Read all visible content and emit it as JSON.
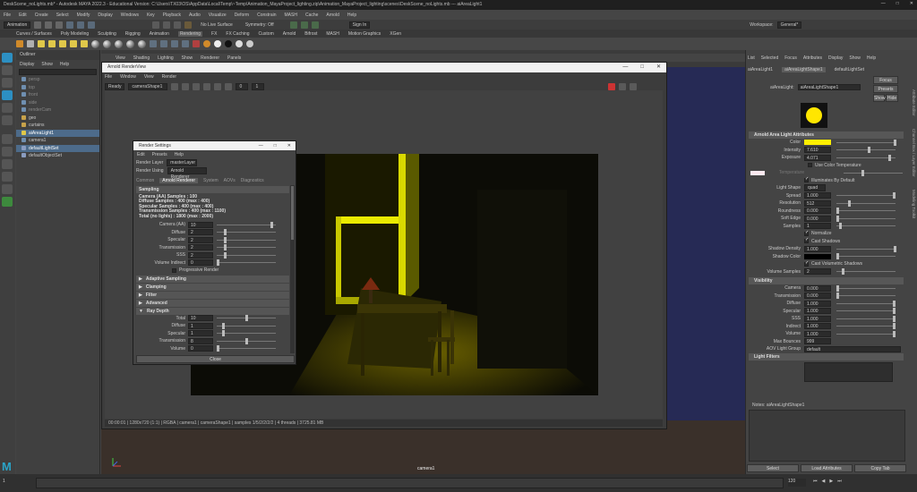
{
  "window": {
    "title": "DeskScene_noLights.mb* - Autodesk MAYA 2022.3 - Educational Version: C:\\Users\\TX03\\OS\\AppData\\Local\\Temp\\~Temp\\Animation_MayaProject_lighting.zip\\Animation_MayaProject_lighting\\scenes\\DeskScene_noLights.mb --- aiAreaLight1"
  },
  "menubar": [
    "File",
    "Edit",
    "Create",
    "Select",
    "Modify",
    "Display",
    "Windows",
    "Key",
    "Playback",
    "Audio",
    "Visualize",
    "Deform",
    "Constrain",
    "MASH",
    "Cache",
    "Arnold",
    "Help"
  ],
  "statusline": {
    "mode": "Animation",
    "no_live_surface": "No Live Surface",
    "symmetry": "Symmetry: Off",
    "sign_in": "Sign In",
    "workspace_label": "Workspace:",
    "workspace": "General*"
  },
  "shelf_tabs": [
    "Curves / Surfaces",
    "Poly Modeling",
    "Sculpting",
    "Rigging",
    "Animation",
    "Rendering",
    "FX",
    "FX Caching",
    "Custom",
    "Arnold",
    "Bifrost",
    "MASH",
    "Motion Graphics",
    "XGen"
  ],
  "shelf_active": "Rendering",
  "outliner": {
    "title": "Outliner",
    "menu": [
      "Display",
      "Show",
      "Help"
    ],
    "items": [
      {
        "label": "persp",
        "color": "#6f8fb0",
        "muted": true
      },
      {
        "label": "top",
        "color": "#6f8fb0",
        "muted": true
      },
      {
        "label": "front",
        "color": "#6f8fb0",
        "muted": true
      },
      {
        "label": "side",
        "color": "#6f8fb0",
        "muted": true
      },
      {
        "label": "renderCam",
        "color": "#6f8fb0",
        "muted": true
      },
      {
        "label": "geo",
        "color": "#c7a24a",
        "muted": false
      },
      {
        "label": "curtains",
        "color": "#c7a24a",
        "muted": false
      },
      {
        "label": "aiAreaLight1",
        "color": "#e0c84a",
        "muted": false,
        "selected": true
      },
      {
        "label": "camera1",
        "color": "#6f8fb0",
        "muted": false
      },
      {
        "label": "defaultLightSet",
        "color": "#8a9cc0",
        "muted": false,
        "selected": true
      },
      {
        "label": "defaultObjectSet",
        "color": "#8a9cc0",
        "muted": false
      }
    ]
  },
  "viewport": {
    "menu": [
      "View",
      "Shading",
      "Lighting",
      "Show",
      "Renderer",
      "Panels"
    ],
    "camera_label": "camera1"
  },
  "render_view": {
    "title": "Arnold RenderView",
    "menu": [
      "File",
      "Window",
      "View",
      "Render"
    ],
    "toolbar": {
      "state": "Ready",
      "camera": "cameraShape1",
      "exposure": "0",
      "gamma": "1"
    },
    "status": "00:00:01 | 1280x720 (1:1) | RGBA | camera1 | cameraShape1 | samples 1/5/2/2/2/2 | 4 threads | 3725.81 MB"
  },
  "render_settings": {
    "title": "Render Settings",
    "menu": [
      "Edit",
      "Presets",
      "Help"
    ],
    "render_layer_label": "Render Layer",
    "render_layer": "masterLayer",
    "render_using_label": "Render Using",
    "render_using": "Arnold Renderer",
    "tabs": [
      "Common",
      "Arnold Renderer",
      "System",
      "AOVs",
      "Diagnostics"
    ],
    "active_tab": "Arnold Renderer",
    "sampling_title": "Sampling",
    "sample_info": [
      "Camera (AA) Samples : 100",
      "Diffuse Samples : 400 (max : 400)",
      "Specular Samples : 400 (max : 400)",
      "Transmission Samples : 400 (max : 1100)",
      "Total (no lights) : 1800 (max : 2000)"
    ],
    "sampling": [
      {
        "label": "Camera (AA)",
        "value": "10",
        "pos": 0.96
      },
      {
        "label": "Diffuse",
        "value": "2",
        "pos": 0.12
      },
      {
        "label": "Specular",
        "value": "2",
        "pos": 0.12
      },
      {
        "label": "Transmission",
        "value": "2",
        "pos": 0.12
      },
      {
        "label": "SSS",
        "value": "2",
        "pos": 0.12
      },
      {
        "label": "Volume Indirect",
        "value": "0",
        "pos": 0.0
      }
    ],
    "progressive_label": "Progressive Render",
    "sections": [
      "Adaptive Sampling",
      "Clamping",
      "Filter",
      "Advanced",
      "Ray Depth"
    ],
    "ray_depth": [
      {
        "label": "Total",
        "value": "10",
        "pos": 0.5
      },
      {
        "label": "Diffuse",
        "value": "1",
        "pos": 0.1
      },
      {
        "label": "Specular",
        "value": "1",
        "pos": 0.1
      },
      {
        "label": "Transmission",
        "value": "8",
        "pos": 0.5
      },
      {
        "label": "Volume",
        "value": "0",
        "pos": 0.0
      }
    ],
    "close_label": "Close"
  },
  "attribute_editor": {
    "menu": [
      "List",
      "Selected",
      "Focus",
      "Attributes",
      "Display",
      "Show",
      "Help"
    ],
    "tabs": [
      "aiAreaLight1",
      "aiAreaLightShape1",
      "defaultLightSet"
    ],
    "active_tab": "aiAreaLightShape1",
    "node_label": "aiAreaLight:",
    "node_value": "aiAreaLightShape1",
    "buttons": {
      "focus": "Focus",
      "presets": "Presets",
      "show": "Show",
      "hide": "Hide"
    },
    "swatch_color": "#ffe600",
    "section_light": "Arnold Area Light Attributes",
    "color_label": "Color",
    "light_color": "#ffef00",
    "attrs1": [
      {
        "label": "Intensity",
        "value": "7.610",
        "pos": 0.55
      },
      {
        "label": "Exposure",
        "value": "4.071",
        "pos": 0.9
      }
    ],
    "use_temp_label": "Use Color Temperature",
    "temp_label": "Temperature",
    "illuminates_label": "Illuminates By Default",
    "shape_label": "Light Shape",
    "shape_value": "quad",
    "attrs2": [
      {
        "label": "Spread",
        "value": "1.000",
        "pos": 0.98
      },
      {
        "label": "Resolution",
        "value": "512",
        "pos": 0.2
      },
      {
        "label": "Roundness",
        "value": "0.000",
        "pos": 0.0
      },
      {
        "label": "Soft Edge",
        "value": "0.000",
        "pos": 0.0
      },
      {
        "label": "Samples",
        "value": "1",
        "pos": 0.05
      }
    ],
    "normalize_label": "Normalize",
    "cast_shadows_label": "Cast Shadows",
    "shadow_density_label": "Shadow Density",
    "shadow_density_value": "1.000",
    "shadow_color_label": "Shadow Color",
    "cast_vol_label": "Cast Volumetric Shadows",
    "vol_samples_label": "Volume Samples",
    "vol_samples_value": "2",
    "section_vis": "Visibility",
    "visibility": [
      {
        "label": "Camera",
        "value": "0.000",
        "pos": 0.0
      },
      {
        "label": "Transmission",
        "value": "0.000",
        "pos": 0.0
      },
      {
        "label": "Diffuse",
        "value": "1.000",
        "pos": 0.98
      },
      {
        "label": "Specular",
        "value": "1.000",
        "pos": 0.98
      },
      {
        "label": "SSS",
        "value": "1.000",
        "pos": 0.98
      },
      {
        "label": "Indirect",
        "value": "1.000",
        "pos": 0.98
      },
      {
        "label": "Volume",
        "value": "1.000",
        "pos": 0.98
      }
    ],
    "max_bounces_label": "Max Bounces",
    "max_bounces_value": "999",
    "aov_label": "AOV Light Group",
    "aov_value": "default",
    "section_filters": "Light Filters",
    "notes_label": "Notes: aiAreaLightShape1",
    "bottom": {
      "select": "Select",
      "load": "Load Attributes",
      "copy": "Copy Tab"
    },
    "side_tabs": [
      "Attribute Editor",
      "Channel Box / Layer Editor",
      "Modeling Toolkit"
    ]
  },
  "timeline": {
    "start": "1",
    "end": "120"
  }
}
